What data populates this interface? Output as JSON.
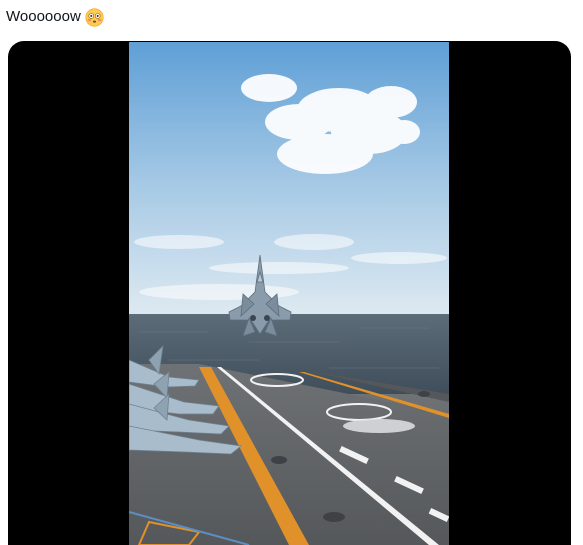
{
  "post": {
    "text": "Woooooow",
    "emoji": "flushed-face-emoji"
  },
  "media": {
    "type": "video",
    "scene": "fighter-jet-carrier-takeoff",
    "colors": {
      "sky_top": "#5f9fd6",
      "sky_bottom": "#dde9f1",
      "sea": "#4c5c69",
      "deck": "#5f6265",
      "deck_stripe_yellow": "#e0912a",
      "deck_stripe_white": "#f2f2f2",
      "jet": "#8a9bab"
    }
  }
}
